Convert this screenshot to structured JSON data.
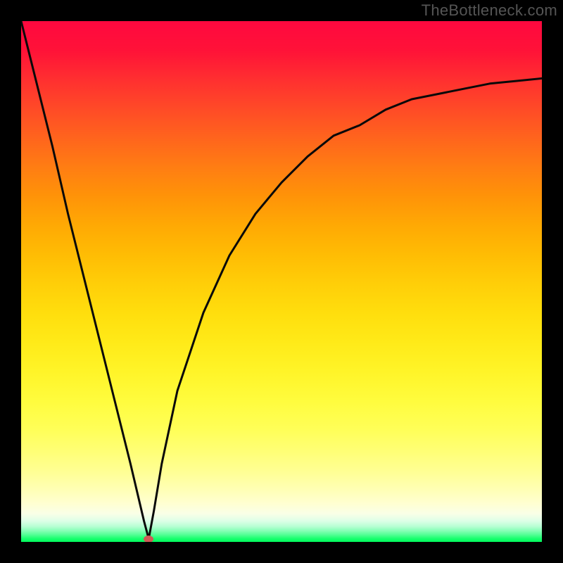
{
  "watermark": "TheBottleneck.com",
  "colors": {
    "curve_stroke": "#090909",
    "marker_fill": "#cf5a56",
    "background": "#000000"
  },
  "marker": {
    "x_fraction": 0.245,
    "y_fraction": 0.994
  },
  "chart_data": {
    "type": "line",
    "title": "",
    "xlabel": "",
    "ylabel": "",
    "xlim": [
      0,
      1
    ],
    "ylim": [
      0,
      1
    ],
    "gradient_axis": "y",
    "gradient_description": "vertical gradient red(top)->orange->yellow->green(bottom) indicating increasing fitness toward bottom",
    "series": [
      {
        "name": "left-branch",
        "description": "near-linear descent from top-left to minimum",
        "x": [
          0.0,
          0.03,
          0.06,
          0.09,
          0.12,
          0.15,
          0.18,
          0.21,
          0.236,
          0.245
        ],
        "y": [
          1.0,
          0.88,
          0.76,
          0.63,
          0.51,
          0.39,
          0.27,
          0.15,
          0.04,
          0.006
        ]
      },
      {
        "name": "right-branch",
        "description": "concave ascent from minimum toward upper-right, flattening",
        "x": [
          0.245,
          0.255,
          0.27,
          0.3,
          0.35,
          0.4,
          0.45,
          0.5,
          0.55,
          0.6,
          0.65,
          0.7,
          0.75,
          0.8,
          0.85,
          0.9,
          0.95,
          1.0
        ],
        "y": [
          0.006,
          0.06,
          0.15,
          0.29,
          0.44,
          0.55,
          0.63,
          0.69,
          0.74,
          0.78,
          0.8,
          0.83,
          0.85,
          0.86,
          0.87,
          0.88,
          0.885,
          0.89
        ]
      }
    ],
    "marker_point": {
      "x": 0.245,
      "y": 0.006,
      "description": "red oval highlighting minimum/optimal point"
    }
  }
}
